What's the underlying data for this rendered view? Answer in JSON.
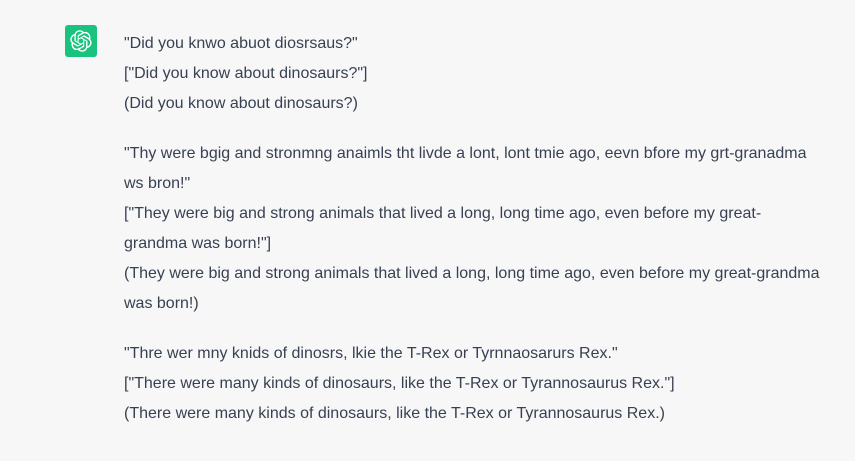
{
  "assistant": {
    "avatar_icon": "openai-logo-icon",
    "avatar_color": "#19c37d"
  },
  "message": {
    "paragraphs": [
      {
        "lines": [
          "\"Did you knwo abuot diosrsaus?\"",
          "[\"Did you know about dinosaurs?\"]",
          "(Did you know about dinosaurs?)"
        ]
      },
      {
        "lines": [
          "\"Thy were bgig and stronmng anaimls tht livde a lont, lont tmie ago, eevn bfore my grt-granadma ws bron!\"",
          "[\"They were big and strong animals that lived a long, long time ago, even before my great-grandma was born!\"]",
          "(They were big and strong animals that lived a long, long time ago, even before my great-grandma was born!)"
        ]
      },
      {
        "lines": [
          "\"Thre wer mny knids of dinosrs, lkie the T-Rex or Tyrnnaosarurs Rex.\"",
          "[\"There were many kinds of dinosaurs, like the T-Rex or Tyrannosaurus Rex.\"]",
          "(There were many kinds of dinosaurs, like the T-Rex or Tyrannosaurus Rex.)"
        ]
      }
    ]
  }
}
